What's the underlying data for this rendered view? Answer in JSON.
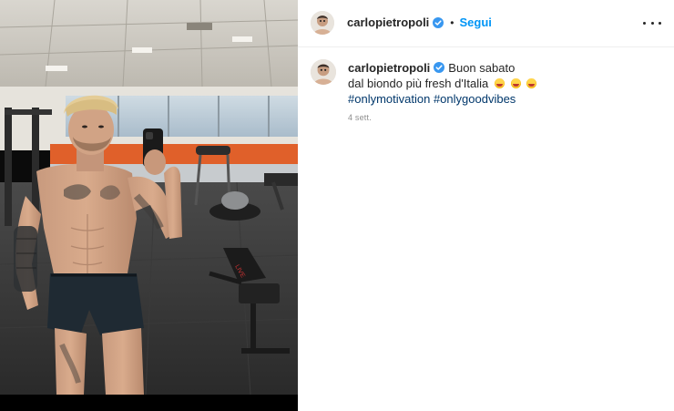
{
  "header": {
    "username": "carlopietropoli",
    "separator": "•",
    "follow_label": "Segui",
    "more_icon": "more-horizontal-icon"
  },
  "caption": {
    "username": "carlopietropoli",
    "line1": "Buon sabato",
    "line2": "dal biondo più fresh d'Italia",
    "hashtags": [
      "#onlymotivation",
      "#onlygoodvibes"
    ],
    "emoji_name": "grinning-face-with-heart-eyes-emoji",
    "emoji_count": 3
  },
  "timestamp": "4 sett.",
  "colors": {
    "accent": "#0095f6",
    "verified": "#3897f0",
    "hashtag": "#00376b",
    "muted": "#8e8e8e"
  },
  "media": {
    "type": "photo",
    "description_icon": "gym-selfie-photo"
  }
}
